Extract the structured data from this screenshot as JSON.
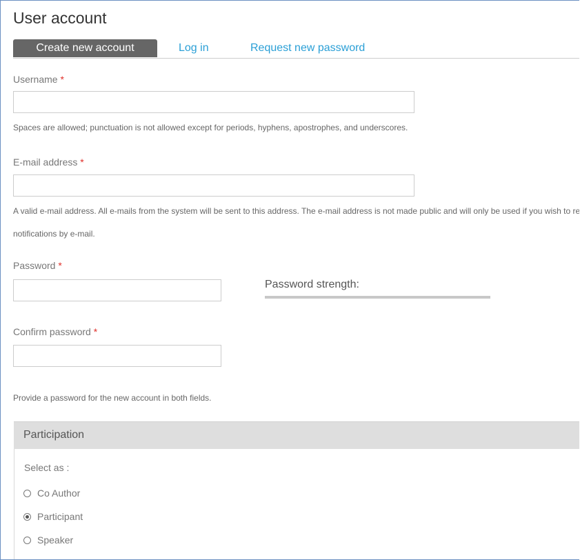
{
  "page": {
    "title": "User account"
  },
  "tabs": [
    {
      "label": "Create new account",
      "active": true
    },
    {
      "label": "Log in",
      "active": false
    },
    {
      "label": "Request new password",
      "active": false
    }
  ],
  "form": {
    "required_marker": "*",
    "username": {
      "label": "Username",
      "value": "",
      "help": "Spaces are allowed; punctuation is not allowed except for periods, hyphens, apostrophes, and underscores."
    },
    "email": {
      "label": "E-mail address",
      "value": "",
      "help_line1": "A valid e-mail address. All e-mails from the system will be sent to this address. The e-mail address is not made public and will only be used if you wish to receive a new password or wish to receive certain news or",
      "help_line2": "notifications by e-mail."
    },
    "password": {
      "label": "Password",
      "value": "",
      "strength_label": "Password strength:",
      "strength_level": 0
    },
    "confirm_password": {
      "label": "Confirm password",
      "value": "",
      "help": "Provide a password for the new account in both fields."
    }
  },
  "participation": {
    "title": "Participation",
    "select_label": "Select as :",
    "options": [
      {
        "label": "Co Author",
        "checked": false
      },
      {
        "label": "Participant",
        "checked": true
      },
      {
        "label": "Speaker",
        "checked": false
      }
    ]
  },
  "colors": {
    "tab_active_bg": "#666666",
    "link": "#2a9fd6",
    "required": "#e0302a",
    "fieldset_header_bg": "#dedede"
  }
}
